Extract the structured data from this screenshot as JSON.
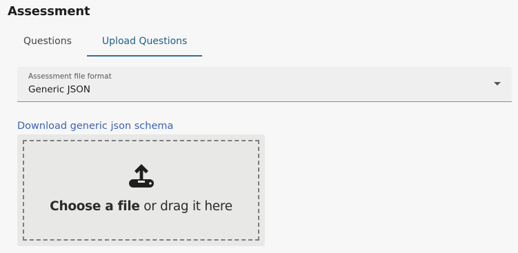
{
  "page": {
    "title": "Assessment"
  },
  "tabs": [
    {
      "label": "Questions",
      "active": false
    },
    {
      "label": "Upload Questions",
      "active": true
    }
  ],
  "file_format": {
    "label": "Assessment file format",
    "value": "Generic JSON",
    "arrow_icon": "caret-down-icon"
  },
  "schema_link": {
    "label": "Download generic json schema",
    "color": "#3a63b8"
  },
  "dropzone": {
    "icon": "upload-icon",
    "choose_text": "Choose a file",
    "rest_text": " or drag it here"
  },
  "colors": {
    "accent": "#2f6f96"
  }
}
